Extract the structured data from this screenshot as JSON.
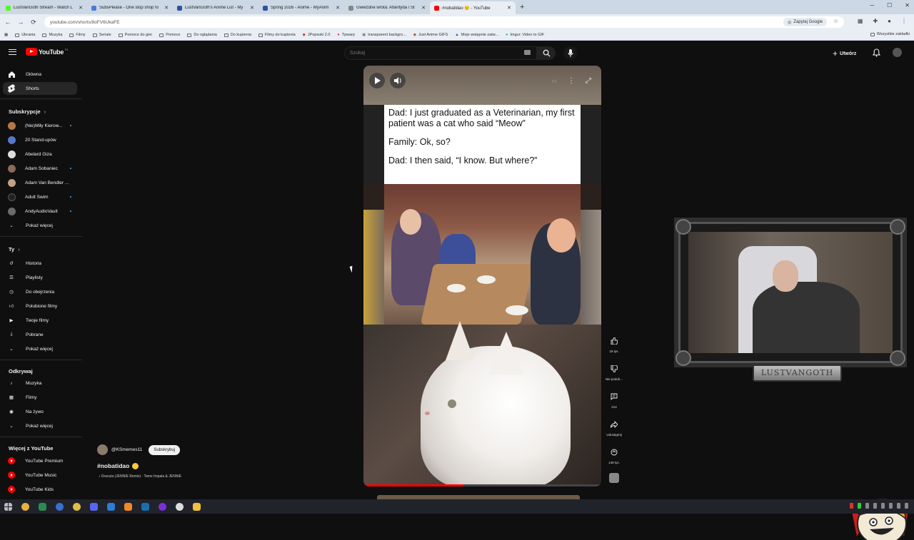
{
  "browser": {
    "tabs": [
      {
        "title": "LustVanGoth Stream - Watch L",
        "color": "#53fc18"
      },
      {
        "title": "SubsPlease - One stop shop fo",
        "color": "#4a7bd4"
      },
      {
        "title": "LustVanGoth's Anime List - My",
        "color": "#2e51a2"
      },
      {
        "title": "Spring 2026 - Anime - MyAnim",
        "color": "#2e51a2"
      },
      {
        "title": "Gwiezdne wrota: Atlantyda / St",
        "color": "#888888"
      },
      {
        "title": "#nobatidao 😊 - YouTube",
        "color": "#ff0000"
      }
    ],
    "url": "youtube.com/shorts/8oFV6UkaFE",
    "google_lens": "Zapytaj Google",
    "bookmarks": [
      "Ubrania",
      "Muzyka",
      "Filmy",
      "Seriale",
      "Pomoce do gier",
      "Pomoce",
      "Do oglądania",
      "Do kupienia",
      "Filmy do kupienia",
      "JPopsuki 2.0",
      "Tpwarp",
      "transparent backgro...",
      "Just Anime GIFS",
      "Moje wstępnie zatw...",
      "Imgur: Video to GIF"
    ],
    "bookmarks_right": "Wszystkie zakładki"
  },
  "youtube": {
    "logo": "YouTube",
    "region": "PL",
    "search_placeholder": "Szukaj",
    "create_label": "Utwórz",
    "nav": {
      "home": "Główna",
      "shorts": "Shorts",
      "subs_header": "Subskrypcje",
      "subscriptions": [
        {
          "name": "(Nie)Miły Kierow...",
          "color": "#b2784a"
        },
        {
          "name": "20 Stand-upów",
          "color": "#5a76c9"
        },
        {
          "name": "Abelard Giza",
          "color": "#dddddd"
        },
        {
          "name": "Adam Sobaniec",
          "color": "#8a6a5a"
        },
        {
          "name": "Adam Van Bendler ...",
          "color": "#c4a083"
        },
        {
          "name": "Adult Swim",
          "color": "#222222"
        },
        {
          "name": "AndyAudioVault",
          "color": "#6b6b6b"
        }
      ],
      "show_more": "Pokaż więcej",
      "you_header": "Ty",
      "you": [
        "Historia",
        "Playlisty",
        "Do obejrzenia",
        "Polubione filmy",
        "Twoje filmy",
        "Pobrane"
      ],
      "explore_header": "Odkrywaj",
      "explore": [
        "Muzyka",
        "Filmy",
        "Na żywo"
      ],
      "more_header": "Więcej z YouTube",
      "more": [
        "YouTube Premium",
        "YouTube Music",
        "YouTube Kids"
      ]
    },
    "short": {
      "meme_lines": [
        "Dad: I just graduated as a Veterinarian, my first patient was a cat who said “Meow”",
        "Family: Ok, so?",
        "Dad: I then said, “I know. But where?”"
      ],
      "progress": 0.42,
      "channel": "@KSmemes11",
      "subscribe": "Subskrybuj",
      "title": "#nobatidao",
      "music": "♪ Dracula (JENNIE Remix) · Tame Impala & JENNIE",
      "likes": "18 tys.",
      "dislike": "Nie podob...",
      "comments": "214",
      "share": "Udostępnij",
      "remix": "148 tys."
    }
  },
  "overlay": {
    "nameplate": "LUSTVANGOTH"
  }
}
